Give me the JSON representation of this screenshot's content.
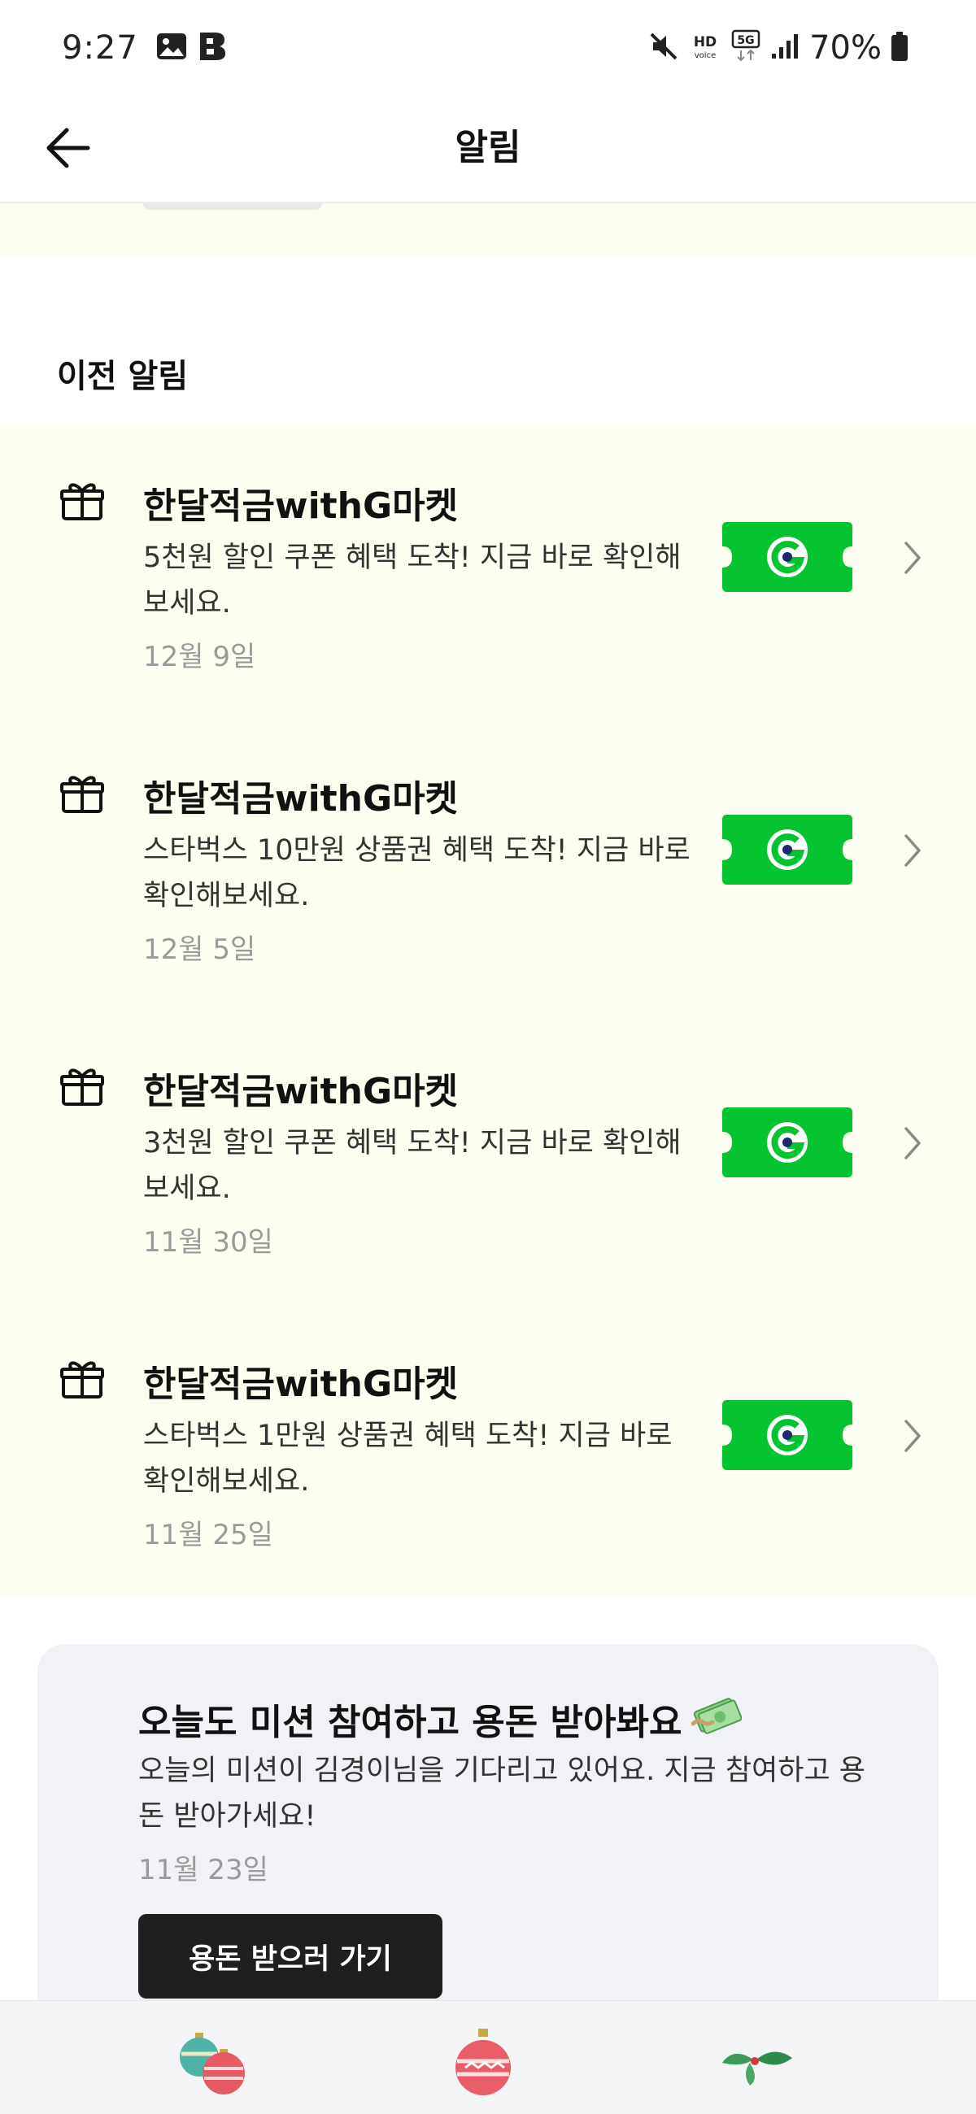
{
  "status_bar": {
    "time": "9:27",
    "battery_percent": "70%",
    "left_icons": [
      "gallery-icon",
      "b-app-icon"
    ],
    "right_icons": [
      "mute-icon",
      "hd-voice-icon",
      "5g-icon",
      "signal-icon",
      "battery-icon"
    ],
    "hd_label": "HD",
    "voice_label": "voice",
    "network_label": "5G"
  },
  "header": {
    "title": "알림",
    "back_icon": "arrow-left-icon"
  },
  "section": {
    "title": "이전 알림"
  },
  "notifications": [
    {
      "title": "한달적금withG마켓",
      "body": "5천원 할인 쿠폰 혜택 도착! 지금 바로 확인해보세요.",
      "date": "12월 9일",
      "icon": "gift-icon",
      "thumbnail": "gmarket-ticket-icon"
    },
    {
      "title": "한달적금withG마켓",
      "body": "스타벅스 10만원 상품권 혜택 도착! 지금 바로 확인해보세요.",
      "date": "12월 5일",
      "icon": "gift-icon",
      "thumbnail": "gmarket-ticket-icon"
    },
    {
      "title": "한달적금withG마켓",
      "body": "3천원 할인 쿠폰 혜택 도착! 지금 바로 확인해보세요.",
      "date": "11월 30일",
      "icon": "gift-icon",
      "thumbnail": "gmarket-ticket-icon"
    },
    {
      "title": "한달적금withG마켓",
      "body": "스타벅스 1만원 상품권 혜택 도착! 지금 바로 확인해보세요.",
      "date": "11월 25일",
      "icon": "gift-icon",
      "thumbnail": "gmarket-ticket-icon"
    }
  ],
  "mission_card": {
    "title": "오늘도 미션 참여하고 용돈 받아봐요",
    "title_icon": "money-icon",
    "body": "오늘의 미션이 김경이님을 기다리고 있어요. 지금 참여하고 용돈 받아가세요!",
    "date": "11월 23일",
    "button_label": "용돈 받으러 가기"
  },
  "bottom_nav": {
    "items": [
      "ornaments-icon",
      "ornament-icon",
      "holly-icon"
    ]
  },
  "colors": {
    "list_background": "#fefef0",
    "gmarket_green": "#06c42f",
    "card_background": "#f0f2f5",
    "button_dark": "#1f1f1f",
    "date_gray": "#9a9a9a"
  }
}
